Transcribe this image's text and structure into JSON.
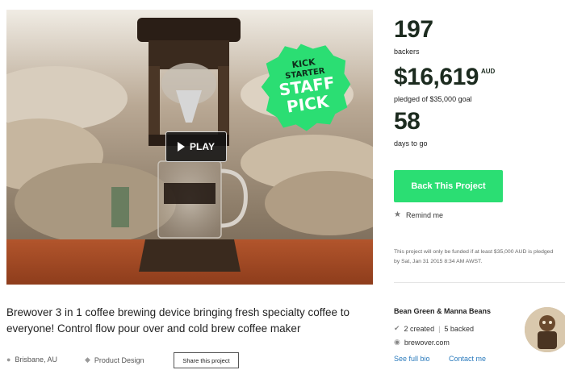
{
  "video": {
    "play_label": "PLAY",
    "badge_lines": [
      "KICK",
      "STARTER",
      "STAFF",
      "PICK"
    ],
    "badge_color": "#2bde73"
  },
  "stats": {
    "backers_count": "197",
    "backers_label": "backers",
    "pledged_amount": "$16,619",
    "pledged_currency": "AUD",
    "pledged_label": "pledged of $35,000 goal",
    "days_count": "58",
    "days_label": "days to go"
  },
  "actions": {
    "back_label": "Back This Project",
    "back_color": "#2bde73",
    "remind_icon": "star-icon",
    "remind_label": "Remind me"
  },
  "funding_note": "This project will only be funded if at least $35,000 AUD is pledged by Sat, Jan 31 2015 8:34 AM AWST.",
  "project": {
    "blurb": "Brewover 3 in 1 coffee brewing device bringing fresh specialty coffee to everyone! Control flow pour over and cold brew coffee maker",
    "location": "Brisbane, AU",
    "location_icon": "map-pin-icon",
    "category": "Product Design",
    "category_icon": "tag-icon",
    "share_label": "Share this project"
  },
  "creator": {
    "name": "Bean Green & Manna Beans",
    "created": "2 created",
    "backed": "5 backed",
    "website": "brewover.com",
    "see_bio_label": "See full bio",
    "contact_label": "Contact me"
  }
}
